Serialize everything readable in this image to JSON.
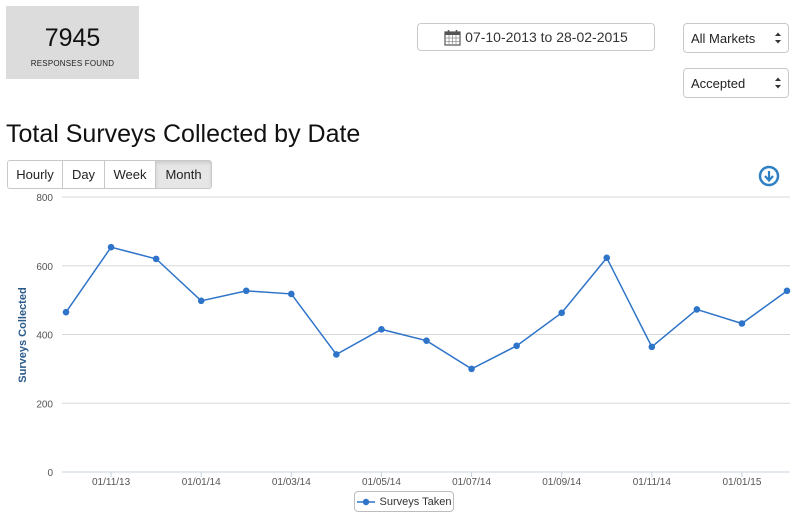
{
  "summary": {
    "count": "7945",
    "label": "RESPONSES FOUND"
  },
  "date_range": {
    "label": "07-10-2013 to 28-02-2015",
    "icon": "calendar-icon"
  },
  "filters": {
    "market": {
      "selected": "All Markets"
    },
    "status": {
      "selected": "Accepted"
    }
  },
  "title": "Total Surveys Collected by Date",
  "granularity": {
    "options": [
      "Hourly",
      "Day",
      "Week",
      "Month"
    ],
    "selected": "Month"
  },
  "download_icon": "download-circle-icon",
  "colors": {
    "series": "#2e74c9",
    "axis_title": "#2a5a8a",
    "grid": "#d8d8d8"
  },
  "chart_data": {
    "type": "line",
    "ylabel": "Surveys Collected",
    "ylim": [
      0,
      800
    ],
    "yticks": [
      0,
      200,
      400,
      600,
      800
    ],
    "xticks": [
      "01/11/13",
      "01/01/14",
      "01/03/14",
      "01/05/14",
      "01/07/14",
      "01/09/14",
      "01/11/14",
      "01/01/15"
    ],
    "grid": true,
    "legend_position": "bottom-center",
    "series": [
      {
        "name": "Surveys Taken",
        "x": [
          "01/10/13",
          "01/11/13",
          "01/12/13",
          "01/01/14",
          "01/02/14",
          "01/03/14",
          "01/04/14",
          "01/05/14",
          "01/06/14",
          "01/07/14",
          "01/08/14",
          "01/09/14",
          "01/10/14",
          "01/11/14",
          "01/12/14",
          "01/01/15",
          "01/02/15"
        ],
        "values": [
          465,
          654,
          620,
          498,
          527,
          518,
          342,
          415,
          382,
          300,
          367,
          463,
          623,
          364,
          473,
          432,
          527
        ]
      }
    ]
  }
}
